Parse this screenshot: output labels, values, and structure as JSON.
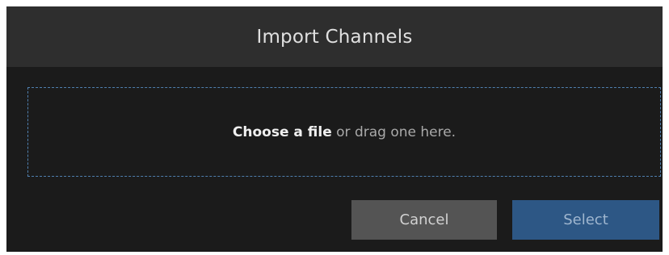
{
  "dialog": {
    "title": "Import Channels"
  },
  "dropzone": {
    "choose_label": "Choose a file",
    "drag_text": " or drag one here."
  },
  "buttons": {
    "cancel_label": "Cancel",
    "select_label": "Select"
  },
  "colors": {
    "dialog_bg": "#1b1b1b",
    "header_bg": "#2e2e2e",
    "dropzone_border": "#4f7fae",
    "cancel_bg": "#545454",
    "select_bg": "#2d5785"
  }
}
